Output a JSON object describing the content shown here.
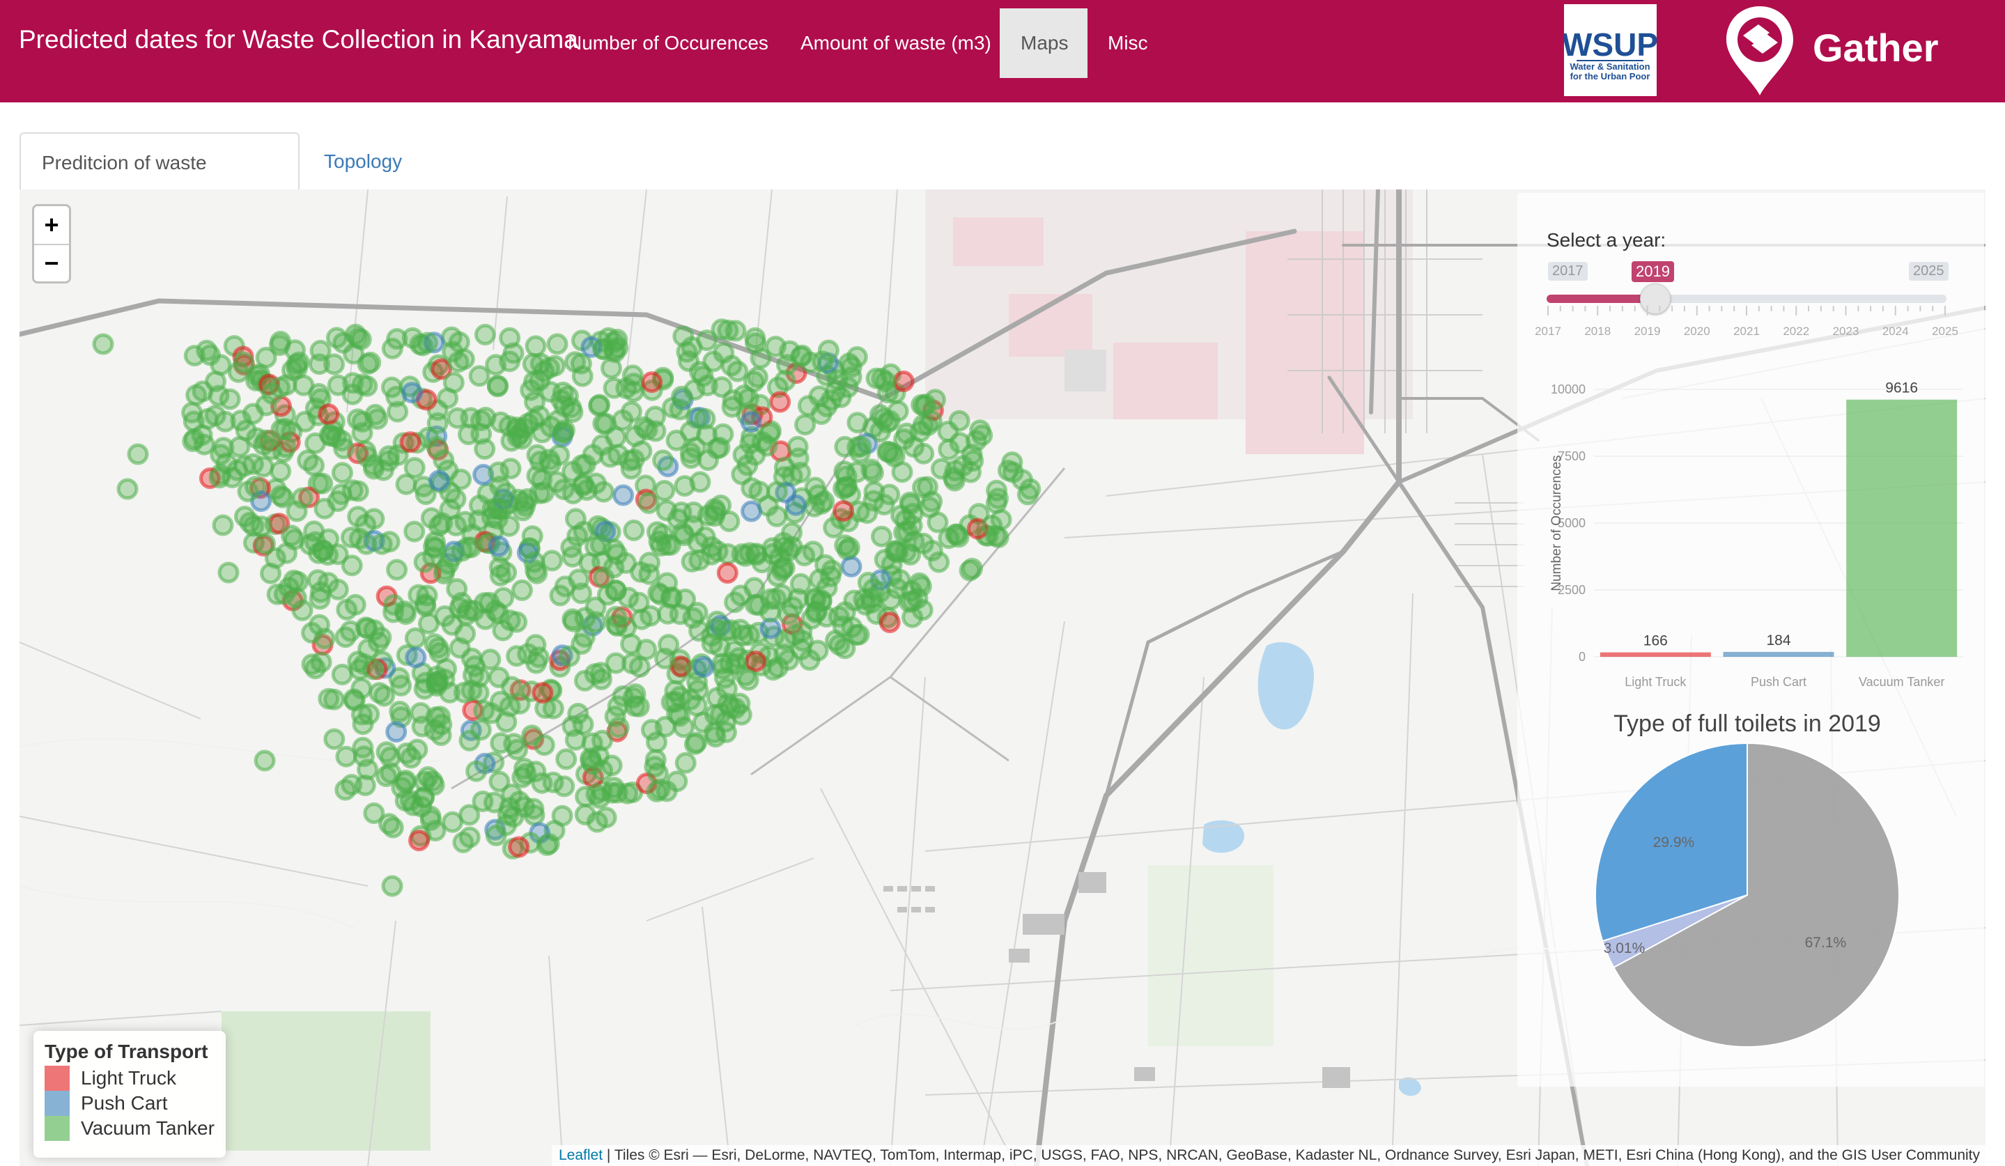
{
  "navbar": {
    "brand": "Predicted dates for Waste Collection in Kanyama",
    "items": [
      "Number of Occurences",
      "Amount of waste (m3)",
      "Maps",
      "Misc"
    ],
    "active": "Maps",
    "color": "#b00d4c",
    "logos": {
      "wsup": {
        "title": "WSUP",
        "subtitle": [
          "Water & Sanitation",
          "for the Urban Poor"
        ]
      },
      "gather": {
        "name": "Gather"
      }
    }
  },
  "tabs": {
    "active": "Preditcion of waste collection",
    "other": "Topology"
  },
  "map": {
    "zoom_in": "+",
    "zoom_out": "−",
    "legend": {
      "title": "Type of Transport",
      "items": [
        {
          "label": "Light Truck",
          "color": "#e41a1c"
        },
        {
          "label": "Push Cart",
          "color": "#377eb8"
        },
        {
          "label": "Vacuum Tanker",
          "color": "#4daf4a"
        }
      ]
    },
    "attribution": {
      "link": "Leaflet",
      "text": "| Tiles © Esri — Esri, DeLorme, NAVTEQ, TomTom, Intermap, iPC, USGS, FAO, NPS, NRCAN, GeoBase, Kadaster NL, Ordnance Survey, Esri Japan, METI, Esri China (Hong Kong), and the GIS User Community"
    }
  },
  "year_slider": {
    "label": "Select a year:",
    "min": 2017,
    "max": 2025,
    "value": 2019,
    "grid": [
      "2017",
      "2018",
      "2019",
      "2020",
      "2021",
      "2022",
      "2023",
      "2024",
      "2025"
    ],
    "color": "#c0436f"
  },
  "chart_data": [
    {
      "type": "bar",
      "categories": [
        "Light Truck",
        "Push Cart",
        "Vacuum Tanker"
      ],
      "values": [
        166,
        184,
        9616
      ],
      "ylabel": "Number of Occurences",
      "ylim": [
        0,
        10000
      ],
      "yticks": [
        0,
        2500,
        5000,
        7500,
        10000
      ],
      "colors": [
        "#e41a1c",
        "#377eb8",
        "#4daf4a"
      ],
      "grid": true
    },
    {
      "type": "pie",
      "title": "Type of full toilets in 2019",
      "slices": [
        {
          "value": 67.1,
          "label": "67.1%",
          "color": "#999999"
        },
        {
          "value": 3.01,
          "label": "3.01%",
          "color": "#a6b4e0"
        },
        {
          "value": 29.9,
          "label": "29.9%",
          "color": "#3f8fd2"
        }
      ]
    }
  ]
}
